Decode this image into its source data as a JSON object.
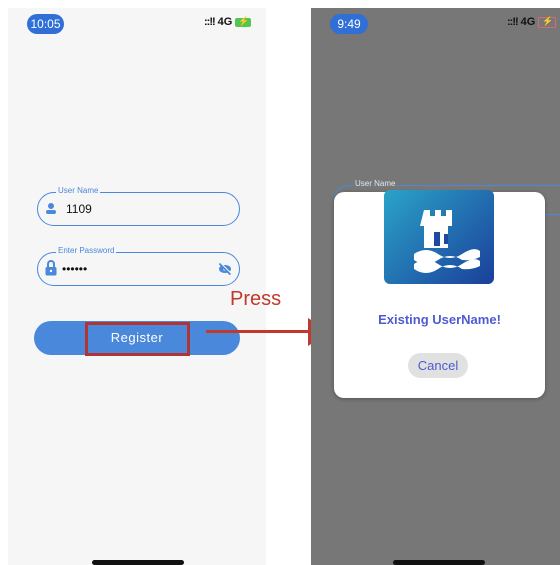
{
  "left_screen": {
    "time": "10:05",
    "signal": "4G",
    "username": {
      "label": "User Name",
      "value": "1109"
    },
    "password": {
      "label": "Enter Password",
      "value": "••••••"
    },
    "register_label": "Register"
  },
  "annotation": {
    "label": "Press"
  },
  "right_screen": {
    "time": "9:49",
    "signal": "4G",
    "username_label": "User Name",
    "dialog": {
      "message": "Existing UserName!",
      "cancel_label": "Cancel"
    }
  },
  "colors": {
    "accent": "#4a88db",
    "annotation": "#c0392b",
    "dialog_text": "#4d5cd0"
  }
}
